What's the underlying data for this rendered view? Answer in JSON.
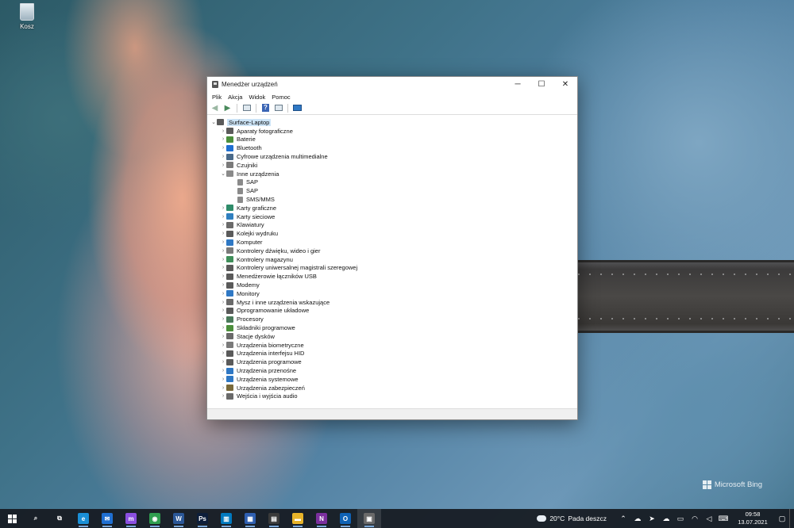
{
  "desktop": {
    "recycle_bin_label": "Kosz",
    "watermark": "Microsoft Bing"
  },
  "window": {
    "title": "Menedżer urządzeń",
    "controls": {
      "minimize": "─",
      "maximize": "☐",
      "close": "✕"
    },
    "menu": [
      "Plik",
      "Akcja",
      "Widok",
      "Pomoc"
    ],
    "toolbar": [
      "back-arrow-icon",
      "forward-arrow-icon",
      "properties-icon",
      "help-icon",
      "view-icon",
      "monitor-icon"
    ]
  },
  "tree": {
    "root": "Surface-Laptop",
    "categories": [
      {
        "label": "Aparaty fotograficzne",
        "icon": "camera-icon",
        "color": "#5b5b5b",
        "expanded": false
      },
      {
        "label": "Baterie",
        "icon": "battery-icon",
        "color": "#4c8f3c",
        "expanded": false
      },
      {
        "label": "Bluetooth",
        "icon": "bluetooth-icon",
        "color": "#1f6fd1",
        "expanded": false
      },
      {
        "label": "Cyfrowe urządzenia multimedialne",
        "icon": "media-device-icon",
        "color": "#4a6a8a",
        "expanded": false
      },
      {
        "label": "Czujniki",
        "icon": "sensor-icon",
        "color": "#7a7a7a",
        "expanded": false
      },
      {
        "label": "Inne urządzenia",
        "icon": "unknown-device-icon",
        "color": "#8a8a8a",
        "expanded": true,
        "children": [
          "SAP",
          "SAP",
          "SMS/MMS"
        ]
      },
      {
        "label": "Karty graficzne",
        "icon": "display-adapter-icon",
        "color": "#2f8c6a",
        "expanded": false
      },
      {
        "label": "Karty sieciowe",
        "icon": "network-adapter-icon",
        "color": "#2f7fbf",
        "expanded": false
      },
      {
        "label": "Klawiatury",
        "icon": "keyboard-icon",
        "color": "#6a6a6a",
        "expanded": false
      },
      {
        "label": "Kolejki wydruku",
        "icon": "printer-icon",
        "color": "#5a5a5a",
        "expanded": false
      },
      {
        "label": "Komputer",
        "icon": "computer-icon",
        "color": "#2f78c4",
        "expanded": false
      },
      {
        "label": "Kontrolery dźwięku, wideo i gier",
        "icon": "sound-icon",
        "color": "#7a7a7a",
        "expanded": false
      },
      {
        "label": "Kontrolery magazynu",
        "icon": "storage-controller-icon",
        "color": "#3f8f5a",
        "expanded": false
      },
      {
        "label": "Kontrolery uniwersalnej magistrali szeregowej",
        "icon": "usb-icon",
        "color": "#5a5a5a",
        "expanded": false
      },
      {
        "label": "Menedżerowie łączników USB",
        "icon": "usb-connector-icon",
        "color": "#5a5a5a",
        "expanded": false
      },
      {
        "label": "Modemy",
        "icon": "modem-icon",
        "color": "#5a5a5a",
        "expanded": false
      },
      {
        "label": "Monitory",
        "icon": "monitor-icon",
        "color": "#2f78c4",
        "expanded": false
      },
      {
        "label": "Mysz i inne urządzenia wskazujące",
        "icon": "mouse-icon",
        "color": "#6a6a6a",
        "expanded": false
      },
      {
        "label": "Oprogramowanie układowe",
        "icon": "firmware-icon",
        "color": "#5a5a5a",
        "expanded": false
      },
      {
        "label": "Procesory",
        "icon": "processor-icon",
        "color": "#4a7a5a",
        "expanded": false
      },
      {
        "label": "Składniki programowe",
        "icon": "software-component-icon",
        "color": "#4c8f3c",
        "expanded": false
      },
      {
        "label": "Stacje dysków",
        "icon": "disk-drive-icon",
        "color": "#6a6a6a",
        "expanded": false
      },
      {
        "label": "Urządzenia biometryczne",
        "icon": "biometric-icon",
        "color": "#7a7a7a",
        "expanded": false
      },
      {
        "label": "Urządzenia interfejsu HID",
        "icon": "hid-icon",
        "color": "#5a5a5a",
        "expanded": false
      },
      {
        "label": "Urządzenia programowe",
        "icon": "software-device-icon",
        "color": "#5a5a5a",
        "expanded": false
      },
      {
        "label": "Urządzenia przenośne",
        "icon": "portable-device-icon",
        "color": "#2f78c4",
        "expanded": false
      },
      {
        "label": "Urządzenia systemowe",
        "icon": "system-device-icon",
        "color": "#2f78c4",
        "expanded": false
      },
      {
        "label": "Urządzenia zabezpieczeń",
        "icon": "security-device-icon",
        "color": "#7a6a3a",
        "expanded": false
      },
      {
        "label": "Wejścia i wyjścia audio",
        "icon": "audio-io-icon",
        "color": "#6a6a6a",
        "expanded": false
      }
    ]
  },
  "taskbar": {
    "apps": [
      {
        "name": "search-icon",
        "glyph": "⌕",
        "bg": "transparent"
      },
      {
        "name": "task-view-icon",
        "glyph": "⧉",
        "bg": "transparent"
      },
      {
        "name": "edge-icon",
        "glyph": "e",
        "bg": "#1a8fd6"
      },
      {
        "name": "mail-icon",
        "glyph": "✉",
        "bg": "#1f6fd1"
      },
      {
        "name": "messenger-icon",
        "glyph": "m",
        "bg": "#8a4fe0"
      },
      {
        "name": "chrome-icon",
        "glyph": "◉",
        "bg": "#2f9e4f"
      },
      {
        "name": "word-icon",
        "glyph": "W",
        "bg": "#2b5797"
      },
      {
        "name": "photoshop-icon",
        "glyph": "Ps",
        "bg": "#0d1e3a"
      },
      {
        "name": "trello-icon",
        "glyph": "▥",
        "bg": "#0079bf"
      },
      {
        "name": "outlook-calendar-icon",
        "glyph": "▦",
        "bg": "#2f5fb0"
      },
      {
        "name": "calculator-icon",
        "glyph": "▤",
        "bg": "#3a3a3a"
      },
      {
        "name": "file-explorer-icon",
        "glyph": "▬",
        "bg": "#e8b42a"
      },
      {
        "name": "onenote-icon",
        "glyph": "N",
        "bg": "#7b2f9e"
      },
      {
        "name": "outlook-icon",
        "glyph": "O",
        "bg": "#0f62b5"
      },
      {
        "name": "device-manager-icon",
        "glyph": "▣",
        "bg": "#6a6a6a"
      }
    ],
    "weather_temp": "20°C",
    "weather_text": "Pada deszcz",
    "tray": [
      "chevron-up-icon",
      "onedrive-icon",
      "telegram-icon",
      "cloud-icon",
      "battery-icon",
      "wifi-icon",
      "volume-icon",
      "language-icon"
    ],
    "time": "09:58",
    "date": "13.07.2021"
  }
}
